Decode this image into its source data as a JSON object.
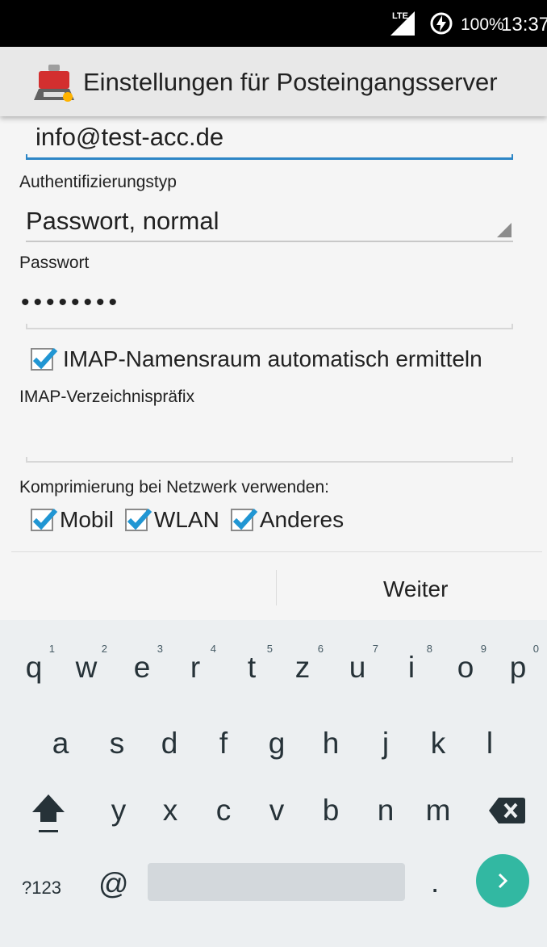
{
  "status_bar": {
    "network": "LTE",
    "battery": "100%",
    "time": "13:37"
  },
  "action_bar": {
    "title": "Einstellungen für Posteingangsserver"
  },
  "form": {
    "username_value": "info@test-acc.de",
    "auth_label": "Authentifizierungstyp",
    "auth_value": "Passwort, normal",
    "password_label": "Passwort",
    "password_value": "••••••••",
    "imap_namespace_label": "IMAP-Namensraum automatisch ermitteln",
    "imap_namespace_checked": true,
    "imap_prefix_label": "IMAP-Verzeichnispräfix",
    "imap_prefix_value": "",
    "compression_label": "Komprimierung bei Netzwerk verwenden:",
    "compression_options": [
      {
        "label": "Mobil",
        "checked": true
      },
      {
        "label": "WLAN",
        "checked": true
      },
      {
        "label": "Anderes",
        "checked": true
      }
    ]
  },
  "buttons": {
    "next_label": "Weiter"
  },
  "keyboard": {
    "row1": [
      {
        "key": "q",
        "hint": "1"
      },
      {
        "key": "w",
        "hint": "2"
      },
      {
        "key": "e",
        "hint": "3"
      },
      {
        "key": "r",
        "hint": "4"
      },
      {
        "key": "t",
        "hint": "5"
      },
      {
        "key": "z",
        "hint": "6"
      },
      {
        "key": "u",
        "hint": "7"
      },
      {
        "key": "i",
        "hint": "8"
      },
      {
        "key": "o",
        "hint": "9"
      },
      {
        "key": "p",
        "hint": "0"
      }
    ],
    "row2": [
      "a",
      "s",
      "d",
      "f",
      "g",
      "h",
      "j",
      "k",
      "l"
    ],
    "row3": [
      "y",
      "x",
      "c",
      "v",
      "b",
      "n",
      "m"
    ],
    "symbols_label": "?123",
    "at_label": "@",
    "period_label": ".",
    "accent_color": "#32b8a2"
  },
  "colors": {
    "focus_accent": "#2d86c6",
    "checkbox_check": "#2196d3"
  }
}
